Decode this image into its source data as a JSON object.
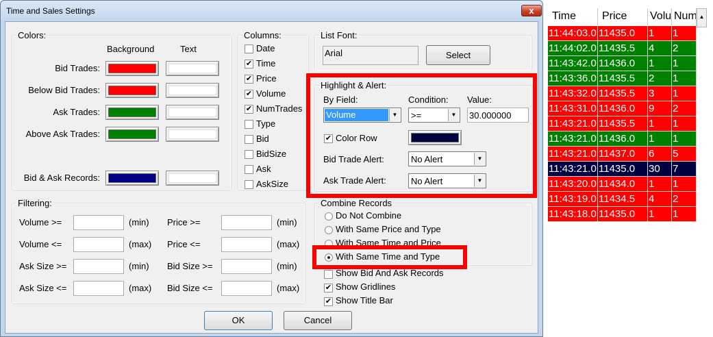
{
  "dialog": {
    "title": "Time and Sales Settings",
    "close_glyph": "x",
    "colors": {
      "legend": "Colors:",
      "header_background": "Background",
      "header_text": "Text",
      "rows": [
        {
          "label": "Bid Trades:",
          "bg": "#ff0000",
          "text_color": "#ffffff"
        },
        {
          "label": "Below Bid Trades:",
          "bg": "#ff0000",
          "text_color": "#ffffff"
        },
        {
          "label": "Ask Trades:",
          "bg": "#008000",
          "text_color": "#ffffff"
        },
        {
          "label": "Above Ask Trades:",
          "bg": "#008000",
          "text_color": "#ffffff"
        },
        {
          "label": "Bid & Ask Records:",
          "bg": "#000080",
          "text_color": "#ffffff"
        }
      ]
    },
    "columns": {
      "legend": "Columns:",
      "items": [
        {
          "label": "Date",
          "checked": false,
          "mark": ""
        },
        {
          "label": "Time",
          "checked": true,
          "mark": "✔"
        },
        {
          "label": "Price",
          "checked": true,
          "mark": "✔"
        },
        {
          "label": "Volume",
          "checked": true,
          "mark": "✔"
        },
        {
          "label": "NumTrades",
          "checked": true,
          "mark": "✔"
        },
        {
          "label": "Type",
          "checked": false,
          "mark": ""
        },
        {
          "label": "Bid",
          "checked": false,
          "mark": ""
        },
        {
          "label": "BidSize",
          "checked": false,
          "mark": ""
        },
        {
          "label": "Ask",
          "checked": false,
          "mark": ""
        },
        {
          "label": "AskSize",
          "checked": false,
          "mark": ""
        }
      ]
    },
    "list_font": {
      "legend": "List Font:",
      "value": "Arial",
      "select_label": "Select"
    },
    "highlight": {
      "legend": "Highlight & Alert:",
      "by_field_label": "By Field:",
      "by_field_value": "Volume",
      "condition_label": "Condition:",
      "condition_value": ">=",
      "value_label": "Value:",
      "value": "30.000000",
      "color_row_label": "Color Row",
      "color_row_checked": true,
      "color_row_mark": "✔",
      "color_row_color": "#000040",
      "bid_alert_label": "Bid Trade Alert:",
      "bid_alert_value": "No Alert",
      "ask_alert_label": "Ask Trade Alert:",
      "ask_alert_value": "No Alert",
      "arrow_glyph": "▼"
    },
    "filtering": {
      "legend": "Filtering:",
      "rows": [
        {
          "l_label": "Volume >=",
          "l_unit": "(min)",
          "r_label": "Price >=",
          "r_unit": "(min)"
        },
        {
          "l_label": "Volume <=",
          "l_unit": "(max)",
          "r_label": "Price <=",
          "r_unit": "(max)"
        },
        {
          "l_label": "Ask Size >=",
          "l_unit": "(min)",
          "r_label": "Bid Size >=",
          "r_unit": "(min)"
        },
        {
          "l_label": "Ask Size <=",
          "l_unit": "(max)",
          "r_label": "Bid Size <=",
          "r_unit": "(max)"
        }
      ]
    },
    "combine": {
      "legend": "Combine Records",
      "options": [
        {
          "label": "Do Not Combine",
          "selected": false
        },
        {
          "label": "With Same Price and Type",
          "selected": false
        },
        {
          "label": "With Same Time and Price",
          "selected": false
        },
        {
          "label": "With Same Time and Type",
          "selected": true
        }
      ],
      "checks": [
        {
          "label": "Show Bid And Ask Records",
          "checked": false,
          "mark": ""
        },
        {
          "label": "Show Gridlines",
          "checked": true,
          "mark": "✔"
        },
        {
          "label": "Show Title Bar",
          "checked": true,
          "mark": "✔"
        }
      ]
    },
    "ok_label": "OK",
    "cancel_label": "Cancel"
  },
  "time_and_sales": {
    "headers": [
      "Time",
      "Price",
      "Volu",
      "Num"
    ],
    "scroll_glyph": "▲",
    "rows": [
      {
        "time": "11:44:03.0",
        "price": "11435.0",
        "volume": "1",
        "num": "1",
        "color": "#ff0000"
      },
      {
        "time": "11:44:02.0",
        "price": "11435.5",
        "volume": "4",
        "num": "2",
        "color": "#008000"
      },
      {
        "time": "11:43:42.0",
        "price": "11436.0",
        "volume": "1",
        "num": "1",
        "color": "#008000"
      },
      {
        "time": "11:43:36.0",
        "price": "11435.5",
        "volume": "2",
        "num": "1",
        "color": "#008000"
      },
      {
        "time": "11:43:32.0",
        "price": "11435.5",
        "volume": "3",
        "num": "1",
        "color": "#ff0000"
      },
      {
        "time": "11:43:31.0",
        "price": "11436.0",
        "volume": "9",
        "num": "2",
        "color": "#ff0000"
      },
      {
        "time": "11:43:21.0",
        "price": "11435.5",
        "volume": "1",
        "num": "1",
        "color": "#ff0000"
      },
      {
        "time": "11:43:21.0",
        "price": "11436.0",
        "volume": "1",
        "num": "1",
        "color": "#008000"
      },
      {
        "time": "11:43:21.0",
        "price": "11437.0",
        "volume": "6",
        "num": "5",
        "color": "#ff0000"
      },
      {
        "time": "11:43:21.0",
        "price": "11435.0",
        "volume": "30",
        "num": "7",
        "color": "#000040"
      },
      {
        "time": "11:43:20.0",
        "price": "11434.0",
        "volume": "1",
        "num": "1",
        "color": "#ff0000"
      },
      {
        "time": "11:43:19.0",
        "price": "11434.5",
        "volume": "4",
        "num": "2",
        "color": "#ff0000"
      },
      {
        "time": "11:43:18.0",
        "price": "11435.0",
        "volume": "1",
        "num": "1",
        "color": "#ff0000"
      }
    ]
  }
}
